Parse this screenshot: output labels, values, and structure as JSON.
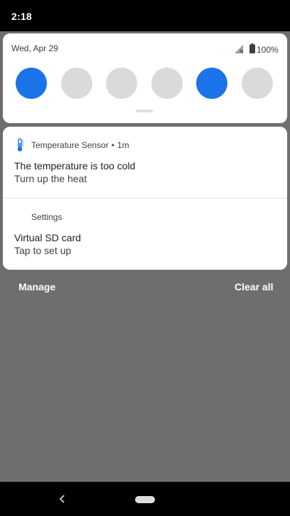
{
  "status_bar": {
    "time": "2:18"
  },
  "quick_settings": {
    "date": "Wed, Apr 29",
    "battery_percent": "100%",
    "tiles": [
      {
        "name": "tile-1",
        "active": true
      },
      {
        "name": "tile-2",
        "active": false
      },
      {
        "name": "tile-3",
        "active": false
      },
      {
        "name": "tile-4",
        "active": false
      },
      {
        "name": "tile-5",
        "active": true
      },
      {
        "name": "tile-6",
        "active": false
      }
    ]
  },
  "notifications": [
    {
      "app": "Temperature Sensor",
      "time": "1m",
      "icon": "thermometer-icon",
      "title": "The temperature is too cold",
      "body": "Turn up the heat"
    },
    {
      "app": "Settings",
      "title": "Virtual SD card",
      "body": "Tap to set up"
    }
  ],
  "actions": {
    "manage": "Manage",
    "clear_all": "Clear all"
  },
  "colors": {
    "accent": "#1a73e8",
    "tile_off": "#dadada",
    "scrim": "#6e6e6e"
  }
}
